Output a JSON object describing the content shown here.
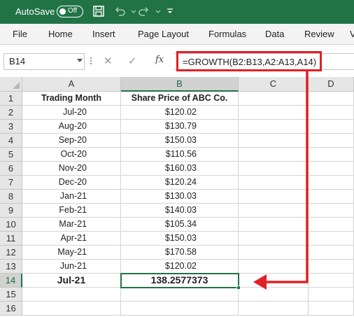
{
  "titlebar": {
    "autosave_label": "AutoSave",
    "autosave_state": "Off",
    "bg_color": "#217346"
  },
  "ribbon": {
    "tabs": [
      "File",
      "Home",
      "Insert",
      "Page Layout",
      "Formulas",
      "Data",
      "Review",
      "V"
    ]
  },
  "formula_bar": {
    "name_box": "B14",
    "fx": "fx",
    "formula": "=GROWTH(B2:B13,A2:A13,A14)"
  },
  "grid": {
    "columns": [
      "A",
      "B",
      "C",
      "D"
    ],
    "selected_column": "B",
    "selected_row": "14",
    "rows": [
      {
        "num": "1",
        "a": "Trading Month",
        "b": "Share Price of ABC Co."
      },
      {
        "num": "2",
        "a": "Jul-20",
        "b": "$120.02"
      },
      {
        "num": "3",
        "a": "Aug-20",
        "b": "$130.79"
      },
      {
        "num": "4",
        "a": "Sep-20",
        "b": "$150.03"
      },
      {
        "num": "5",
        "a": "Oct-20",
        "b": "$110.56"
      },
      {
        "num": "6",
        "a": "Nov-20",
        "b": "$160.03"
      },
      {
        "num": "7",
        "a": "Dec-20",
        "b": "$120.24"
      },
      {
        "num": "8",
        "a": "Jan-21",
        "b": "$130.03"
      },
      {
        "num": "9",
        "a": "Feb-21",
        "b": "$140.03"
      },
      {
        "num": "10",
        "a": "Mar-21",
        "b": "$105.34"
      },
      {
        "num": "11",
        "a": "Apr-21",
        "b": "$150.03"
      },
      {
        "num": "12",
        "a": "May-21",
        "b": "$170.58"
      },
      {
        "num": "13",
        "a": "Jun-21",
        "b": "$120.02"
      },
      {
        "num": "14",
        "a": "Jul-21",
        "b": "138.2577373"
      },
      {
        "num": "15",
        "a": "",
        "b": ""
      },
      {
        "num": "16",
        "a": "",
        "b": ""
      }
    ]
  },
  "annotation": {
    "color": "#e02026"
  }
}
